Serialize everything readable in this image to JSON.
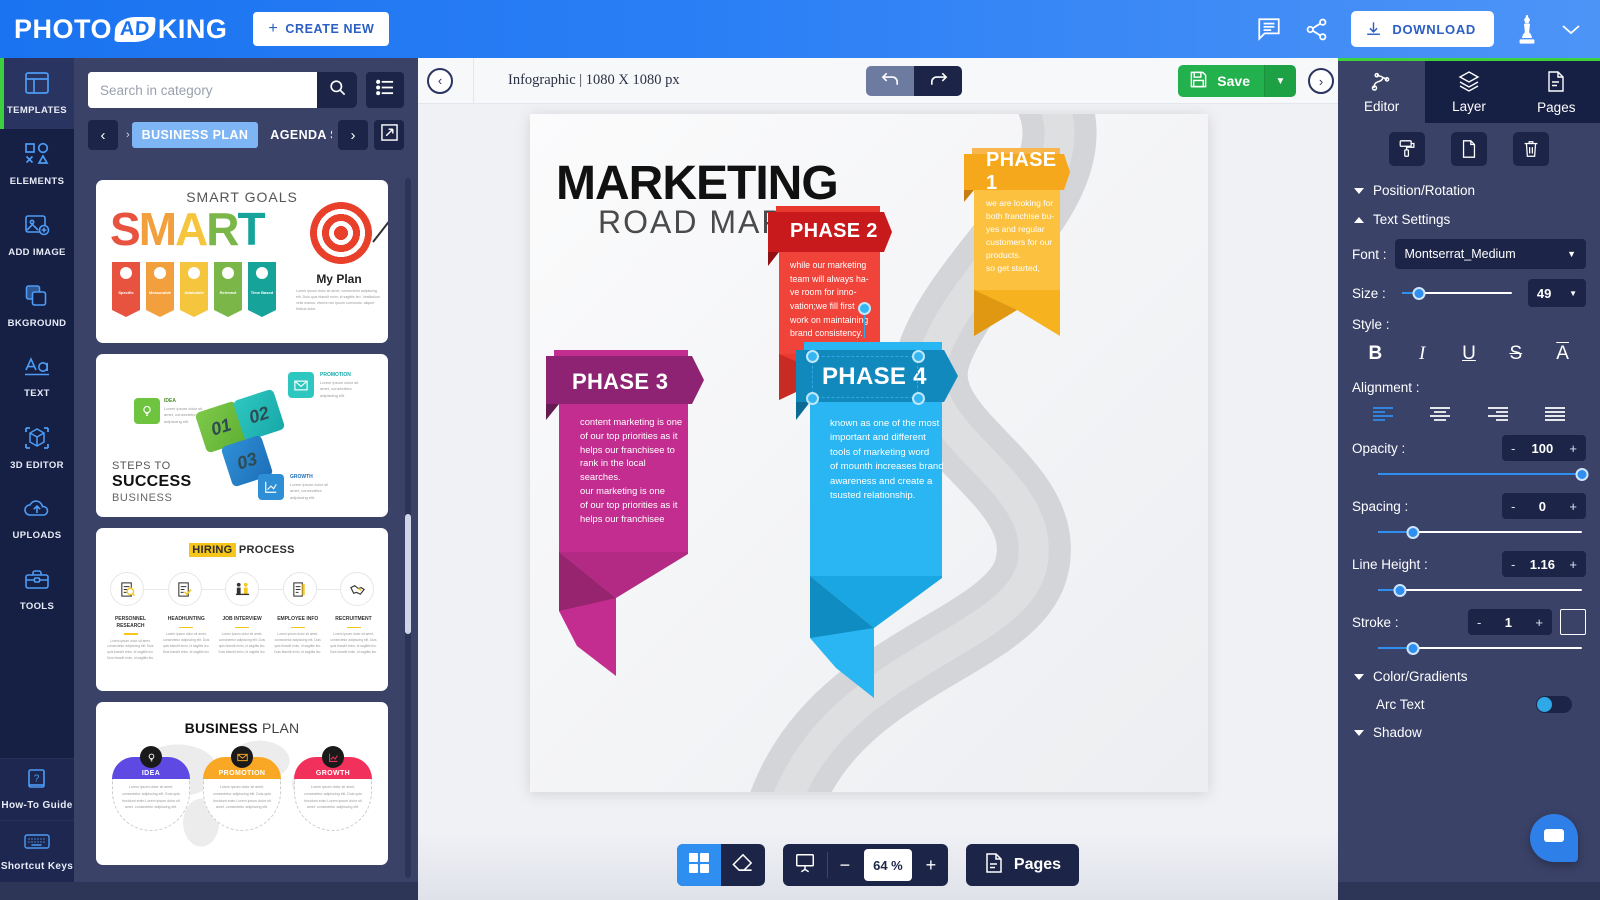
{
  "header": {
    "logo_photo": "PHOTO",
    "logo_ad": "AD",
    "logo_king": "KING",
    "create_new_label": "CREATE NEW",
    "create_new_plus": "+",
    "download_label": "DOWNLOAD",
    "icons": [
      "feedback-icon",
      "share-icon",
      "download-icon",
      "crown-pawn-icon",
      "chevron-down-icon"
    ]
  },
  "rail": {
    "items": [
      {
        "label": "TEMPLATES",
        "icon": "templates-icon",
        "active": true
      },
      {
        "label": "ELEMENTS",
        "icon": "elements-icon",
        "active": false
      },
      {
        "label": "ADD IMAGE",
        "icon": "add-image-icon",
        "active": false
      },
      {
        "label": "BKGROUND",
        "icon": "background-icon",
        "active": false
      },
      {
        "label": "TEXT",
        "icon": "text-icon",
        "active": false
      },
      {
        "label": "3D EDITOR",
        "icon": "cube-3d-icon",
        "active": false
      },
      {
        "label": "UPLOADS",
        "icon": "upload-cloud-icon",
        "active": false
      },
      {
        "label": "TOOLS",
        "icon": "toolbox-icon",
        "active": false
      }
    ],
    "bottom_items": [
      {
        "label": "How-To Guide",
        "icon": "question-book-icon"
      },
      {
        "label": "Shortcut Keys",
        "icon": "keyboard-icon"
      }
    ]
  },
  "panel": {
    "search_placeholder": "Search in category",
    "search_value": "",
    "categories": {
      "ghost_left": "›",
      "items": [
        {
          "label": "BUSINESS PLAN",
          "active": true
        },
        {
          "label": "AGENDA SLIDE",
          "active": false
        }
      ],
      "prev": "‹",
      "next": "›"
    },
    "thumbs": [
      {
        "name": "smart-goals",
        "title": "SMART GOALS",
        "word_letters": [
          "S",
          "M",
          "A",
          "R",
          "T"
        ],
        "ribbon_labels": [
          "Specific",
          "Measurable",
          "Attainable",
          "Relevant",
          "Time Based"
        ],
        "side_title": "My Plan",
        "side_text": "Lorem ipsum dolor sit amet, consectetur adipiscing elit. Duis quis blandit enim, id sagittis leo. Vestibulum velis massa, viverra nec ipsum commodo, aliquet finibus dolor."
      },
      {
        "name": "steps-to-success",
        "cubes": [
          "01",
          "02",
          "03"
        ],
        "nodes": [
          {
            "label": "IDEA",
            "text": "Lorem ipsum dolor sit amet, consectetur adipiscing elit."
          },
          {
            "label": "PROMOTION",
            "text": "Lorem ipsum dolor sit amet, consectetur adipiscing elit."
          },
          {
            "label": "GROWTH",
            "text": "Lorem ipsum dolor sit amet, consectetur adipiscing elit."
          }
        ],
        "foot_a": "STEPS TO",
        "foot_b": "SUCCESS",
        "foot_c": "BUSINESS"
      },
      {
        "name": "hiring-process",
        "title_hl": "HIRING",
        "title_rest": " PROCESS",
        "steps": [
          {
            "label": "PERSONNEL RESEARCH",
            "text": "Lorem ipsum dolor sit amet, consectetur adipiscing elit. Duis quis blandit enim, id sagittis leo. Duis blandit enim, id sagittis leo."
          },
          {
            "label": "HEADHUNTING",
            "text": "Lorem ipsum dolor sit amet, consectetur adipiscing elit. Duis quis blandit enim, id sagittis leo. Duis blandit enim, id sagittis leo."
          },
          {
            "label": "JOB INTERVIEW",
            "text": "Lorem ipsum dolor sit amet, consectetur adipiscing elit. Duis quis blandit enim, id sagittis leo. Duis blandit enim, id sagittis leo."
          },
          {
            "label": "EMPLOYEE INFO",
            "text": "Lorem ipsum dolor sit amet, consectetur adipiscing elit. Duis quis blandit enim, id sagittis leo. Duis blandit enim, id sagittis leo."
          },
          {
            "label": "RECRUITMENT",
            "text": "Lorem ipsum dolor sit amet, consectetur adipiscing elit. Duis quis blandit enim, id sagittis leo. Duis blandit enim, id sagittis leo."
          }
        ]
      },
      {
        "name": "business-plan",
        "title_bold": "BUSINESS",
        "title_light": " PLAN",
        "items": [
          {
            "label": "IDEA",
            "color": "#5e4ae3",
            "text": "Lorem ipsum dolor sit amet, consectetur adipiscing elit. Duis quis tincidunt enim Lorem ipsum dolor sit amet, consectetur adipiscing elit."
          },
          {
            "label": "PROMOTION",
            "color": "#f9a825",
            "text": "Lorem ipsum dolor sit amet, consectetur adipiscing elit. Duis quis tincidunt enim Lorem ipsum dolor sit amet, consectetur adipiscing elit."
          },
          {
            "label": "GROWTH",
            "color": "#f1315b",
            "text": "Lorem ipsum dolor sit amet, consectetur adipiscing elit. Duis quis tincidunt enim Lorem ipsum dolor sit amet, consectetur adipiscing elit."
          }
        ]
      }
    ]
  },
  "canvas_bar": {
    "collapse_left": "‹",
    "doc_title": "Infographic | 1080 X 1080 px",
    "undo_icon": "undo-icon",
    "redo_icon": "redo-icon",
    "save_label": "Save",
    "save_caret": "▼",
    "expand_right": "›"
  },
  "design": {
    "title": "MARKETING",
    "subtitle": "ROAD MAP",
    "phases": [
      {
        "name": "phase-1",
        "heading": "PHASE 1",
        "body": "we are looking for\nboth franchise bu-\nyes and regular\ncustomers for our\nproducts.\nso get started,",
        "color": "#f5a81c",
        "head_color": "#f08c1b",
        "selected": false
      },
      {
        "name": "phase-2",
        "heading": "PHASE 2",
        "body": "while our marketing\nteam will always ha-\nve room for inno-\nvation;we fill first\nwork on maintaining\nbrand consistency.",
        "color": "#f0433a",
        "head_color": "#c8191c",
        "selected": false
      },
      {
        "name": "phase-3",
        "heading": "PHASE 3",
        "body": "content marketing is one\nof our top priorities as it\nhelps our franchisee to\nrank in the local searches.\nour marketing is one\nof our top priorities as it\nhelps our franchisee",
        "color": "#c32d8f",
        "head_color": "#8e2273",
        "selected": false
      },
      {
        "name": "phase-4",
        "heading": "PHASE 4",
        "body": "known as one of the most\nimportant and different\ntools of marketing word\nof mounth increases brand\nawareness and create  a\ntsusted relationship.",
        "color": "#29b6f2",
        "head_color": "#1189bd",
        "selected": true
      }
    ]
  },
  "bottom_bar": {
    "grid_icon": "grid-icon",
    "eraser_icon": "eraser-icon",
    "present_icon": "presentation-icon",
    "zoom_out": "−",
    "zoom_value": "64 %",
    "zoom_in": "+",
    "pages_label": "Pages",
    "pages_icon": "page-icon"
  },
  "props": {
    "tabs": [
      {
        "label": "Editor",
        "icon": "node-path-icon",
        "active": true
      },
      {
        "label": "Layer",
        "icon": "layers-icon",
        "active": false
      },
      {
        "label": "Pages",
        "icon": "page-icon",
        "active": false
      }
    ],
    "actions": [
      {
        "name": "paint-roller-icon"
      },
      {
        "name": "duplicate-icon"
      },
      {
        "name": "trash-icon"
      }
    ],
    "sections": {
      "position_rotation": "Position/Rotation",
      "text_settings": "Text Settings",
      "color_gradients": "Color/Gradients",
      "shadow": "Shadow"
    },
    "font_label": "Font :",
    "font_value": "Montserrat_Medium",
    "size_label": "Size :",
    "size_value": "49",
    "style_label": "Style :",
    "style_buttons": [
      "bold-icon",
      "italic-icon",
      "underline-icon",
      "strikethrough-icon",
      "overline-icon"
    ],
    "alignment_label": "Alignment :",
    "alignment_buttons": [
      "align-left-icon",
      "align-center-icon",
      "align-right-icon",
      "align-justify-icon"
    ],
    "alignment_active": 0,
    "opacity_label": "Opacity :",
    "opacity_value": "100",
    "spacing_label": "Spacing :",
    "spacing_value": "0",
    "line_height_label": "Line Height :",
    "line_height_value": "1.16",
    "stroke_label": "Stroke :",
    "stroke_value": "1",
    "arc_text_label": "Arc Text",
    "minus": "-",
    "plus": "+",
    "caret_down": "▼"
  },
  "chat": {
    "icon": "chat-bubble-icon"
  }
}
